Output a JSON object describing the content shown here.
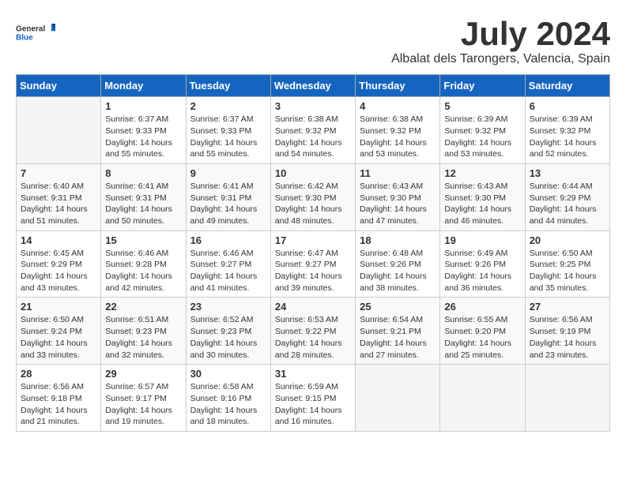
{
  "logo": {
    "general": "General",
    "blue": "Blue"
  },
  "title": "July 2024",
  "subtitle": "Albalat dels Tarongers, Valencia, Spain",
  "days_header": [
    "Sunday",
    "Monday",
    "Tuesday",
    "Wednesday",
    "Thursday",
    "Friday",
    "Saturday"
  ],
  "weeks": [
    [
      {
        "num": "",
        "info": ""
      },
      {
        "num": "1",
        "info": "Sunrise: 6:37 AM\nSunset: 9:33 PM\nDaylight: 14 hours\nand 55 minutes."
      },
      {
        "num": "2",
        "info": "Sunrise: 6:37 AM\nSunset: 9:33 PM\nDaylight: 14 hours\nand 55 minutes."
      },
      {
        "num": "3",
        "info": "Sunrise: 6:38 AM\nSunset: 9:32 PM\nDaylight: 14 hours\nand 54 minutes."
      },
      {
        "num": "4",
        "info": "Sunrise: 6:38 AM\nSunset: 9:32 PM\nDaylight: 14 hours\nand 53 minutes."
      },
      {
        "num": "5",
        "info": "Sunrise: 6:39 AM\nSunset: 9:32 PM\nDaylight: 14 hours\nand 53 minutes."
      },
      {
        "num": "6",
        "info": "Sunrise: 6:39 AM\nSunset: 9:32 PM\nDaylight: 14 hours\nand 52 minutes."
      }
    ],
    [
      {
        "num": "7",
        "info": "Sunrise: 6:40 AM\nSunset: 9:31 PM\nDaylight: 14 hours\nand 51 minutes."
      },
      {
        "num": "8",
        "info": "Sunrise: 6:41 AM\nSunset: 9:31 PM\nDaylight: 14 hours\nand 50 minutes."
      },
      {
        "num": "9",
        "info": "Sunrise: 6:41 AM\nSunset: 9:31 PM\nDaylight: 14 hours\nand 49 minutes."
      },
      {
        "num": "10",
        "info": "Sunrise: 6:42 AM\nSunset: 9:30 PM\nDaylight: 14 hours\nand 48 minutes."
      },
      {
        "num": "11",
        "info": "Sunrise: 6:43 AM\nSunset: 9:30 PM\nDaylight: 14 hours\nand 47 minutes."
      },
      {
        "num": "12",
        "info": "Sunrise: 6:43 AM\nSunset: 9:30 PM\nDaylight: 14 hours\nand 46 minutes."
      },
      {
        "num": "13",
        "info": "Sunrise: 6:44 AM\nSunset: 9:29 PM\nDaylight: 14 hours\nand 44 minutes."
      }
    ],
    [
      {
        "num": "14",
        "info": "Sunrise: 6:45 AM\nSunset: 9:29 PM\nDaylight: 14 hours\nand 43 minutes."
      },
      {
        "num": "15",
        "info": "Sunrise: 6:46 AM\nSunset: 9:28 PM\nDaylight: 14 hours\nand 42 minutes."
      },
      {
        "num": "16",
        "info": "Sunrise: 6:46 AM\nSunset: 9:27 PM\nDaylight: 14 hours\nand 41 minutes."
      },
      {
        "num": "17",
        "info": "Sunrise: 6:47 AM\nSunset: 9:27 PM\nDaylight: 14 hours\nand 39 minutes."
      },
      {
        "num": "18",
        "info": "Sunrise: 6:48 AM\nSunset: 9:26 PM\nDaylight: 14 hours\nand 38 minutes."
      },
      {
        "num": "19",
        "info": "Sunrise: 6:49 AM\nSunset: 9:26 PM\nDaylight: 14 hours\nand 36 minutes."
      },
      {
        "num": "20",
        "info": "Sunrise: 6:50 AM\nSunset: 9:25 PM\nDaylight: 14 hours\nand 35 minutes."
      }
    ],
    [
      {
        "num": "21",
        "info": "Sunrise: 6:50 AM\nSunset: 9:24 PM\nDaylight: 14 hours\nand 33 minutes."
      },
      {
        "num": "22",
        "info": "Sunrise: 6:51 AM\nSunset: 9:23 PM\nDaylight: 14 hours\nand 32 minutes."
      },
      {
        "num": "23",
        "info": "Sunrise: 6:52 AM\nSunset: 9:23 PM\nDaylight: 14 hours\nand 30 minutes."
      },
      {
        "num": "24",
        "info": "Sunrise: 6:53 AM\nSunset: 9:22 PM\nDaylight: 14 hours\nand 28 minutes."
      },
      {
        "num": "25",
        "info": "Sunrise: 6:54 AM\nSunset: 9:21 PM\nDaylight: 14 hours\nand 27 minutes."
      },
      {
        "num": "26",
        "info": "Sunrise: 6:55 AM\nSunset: 9:20 PM\nDaylight: 14 hours\nand 25 minutes."
      },
      {
        "num": "27",
        "info": "Sunrise: 6:56 AM\nSunset: 9:19 PM\nDaylight: 14 hours\nand 23 minutes."
      }
    ],
    [
      {
        "num": "28",
        "info": "Sunrise: 6:56 AM\nSunset: 9:18 PM\nDaylight: 14 hours\nand 21 minutes."
      },
      {
        "num": "29",
        "info": "Sunrise: 6:57 AM\nSunset: 9:17 PM\nDaylight: 14 hours\nand 19 minutes."
      },
      {
        "num": "30",
        "info": "Sunrise: 6:58 AM\nSunset: 9:16 PM\nDaylight: 14 hours\nand 18 minutes."
      },
      {
        "num": "31",
        "info": "Sunrise: 6:59 AM\nSunset: 9:15 PM\nDaylight: 14 hours\nand 16 minutes."
      },
      {
        "num": "",
        "info": ""
      },
      {
        "num": "",
        "info": ""
      },
      {
        "num": "",
        "info": ""
      }
    ]
  ]
}
